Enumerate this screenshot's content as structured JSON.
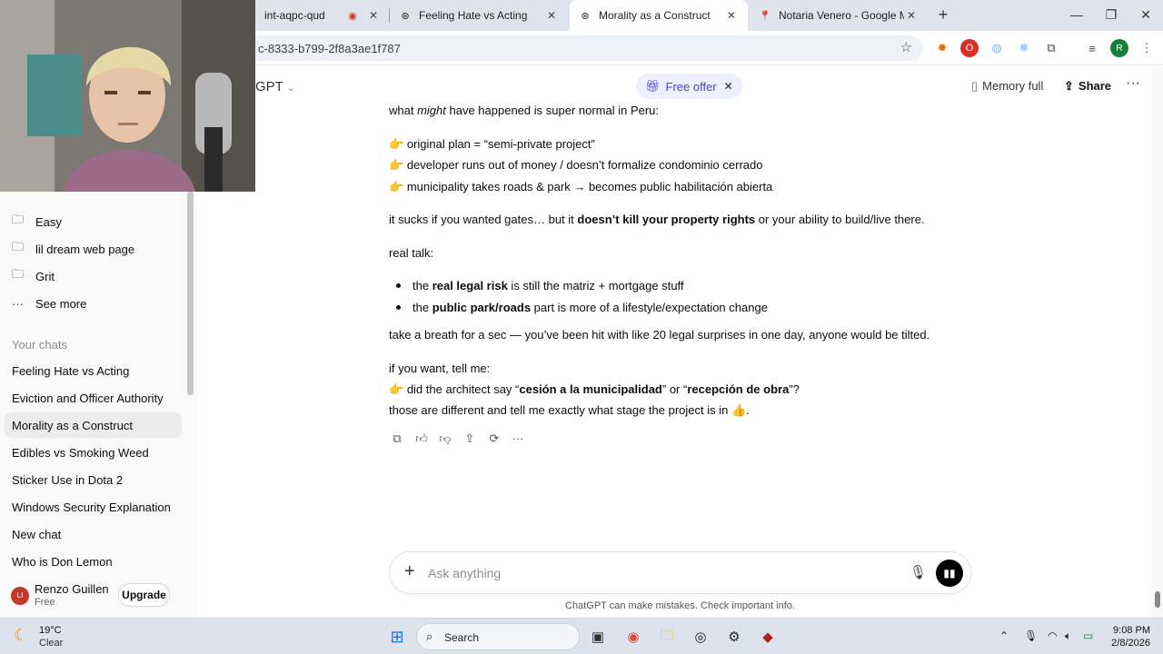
{
  "browser": {
    "tabs": [
      {
        "label": "int-aqpc-qud",
        "icon": "recording-icon",
        "active": false
      },
      {
        "label": "Feeling Hate vs Acting",
        "icon": "chatgpt-icon",
        "active": false
      },
      {
        "label": "Morality as a Construct",
        "icon": "chatgpt-icon",
        "active": true
      },
      {
        "label": "Notaria Venero - Google Maps",
        "icon": "maps-pin-icon",
        "active": false
      }
    ],
    "url": "c-8333-b799-2f8a3ae1f787",
    "profile_initial": "R"
  },
  "sidebar": {
    "items": [
      {
        "label": "Easy",
        "icon": "folder-icon"
      },
      {
        "label": "lil dream web page",
        "icon": "folder-icon"
      },
      {
        "label": "Grit",
        "icon": "folder-icon"
      },
      {
        "label": "See more",
        "icon": "more-icon"
      }
    ],
    "section_title": "Your chats",
    "chats": [
      "Feeling Hate vs Acting",
      "Eviction and Officer Authority",
      "Morality as a Construct",
      "Edibles vs Smoking Weed",
      "Sticker Use in Dota 2",
      "Windows Security Explanation",
      "New chat",
      "Who is Don Lemon"
    ],
    "active_chat": "Morality as a Construct",
    "user": {
      "name": "Renzo Guillen",
      "plan": "Free",
      "initials": "LI",
      "upgrade_label": "Upgrade"
    }
  },
  "header": {
    "model": "GPT",
    "offer_label": "Free offer",
    "memory_label": "Memory full",
    "share_label": "Share"
  },
  "message": {
    "line1_pre": "what ",
    "line1_em": "might",
    "line1_post": " have happened is super normal in Peru:",
    "point1": "original plan = “semi-private project”",
    "point2": "developer runs out of money / doesn’t formalize condominio cerrado",
    "point3": "municipality takes roads & park → becomes public habilitación abierta",
    "sucks_pre": "it sucks if you wanted gates… but it ",
    "sucks_bold": "doesn’t kill your property rights",
    "sucks_post": " or your ability to build/live there.",
    "real_talk": "real talk:",
    "b1_pre": "the ",
    "b1_bold": "real legal risk",
    "b1_post": " is still the matriz + mortgage stuff",
    "b2_pre": "the ",
    "b2_bold": "public park/roads",
    "b2_post": " part is more of a lifestyle/expectation change",
    "breath": "take a breath for a sec — you’ve been hit with like 20 legal surprises in one day, anyone would be tilted.",
    "ifwant": "if you want, tell me:",
    "q_pre": "did the architect say “",
    "q_bold1": "cesión a la municipalidad",
    "q_mid": "” or “",
    "q_bold2": "recepción de obra",
    "q_post": "”?",
    "last": "those are different and tell me exactly what stage the project is in",
    "emoji_point": "👉",
    "emoji_end": "👍",
    "last_end": "."
  },
  "composer": {
    "placeholder": "Ask anything",
    "disclaimer": "ChatGPT can make mistakes. Check important info."
  },
  "taskbar": {
    "temp": "19°C",
    "weather": "Clear",
    "search_label": "Search",
    "time": "9:08 PM",
    "date": "2/8/2026"
  }
}
